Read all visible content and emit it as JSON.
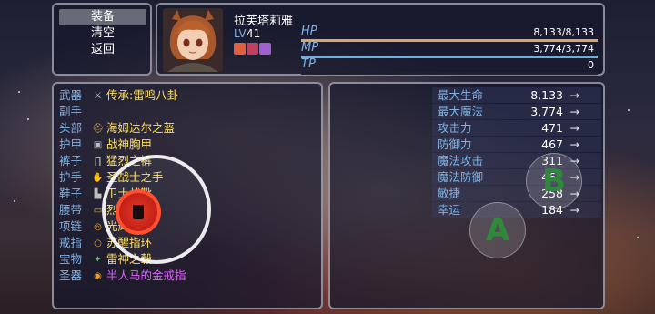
{
  "command_window": {
    "items": [
      {
        "label": "装备",
        "selected": true
      },
      {
        "label": "清空",
        "selected": false
      },
      {
        "label": "返回",
        "selected": false
      }
    ]
  },
  "actor": {
    "name": "拉芙塔莉雅",
    "level_label": "LV",
    "level": "41",
    "state_icons": [
      "attack-up-icon",
      "defense-up-icon",
      "magic-up-icon"
    ],
    "hp": {
      "label": "HP",
      "text": "8,133/8,133",
      "ratio": 1.0,
      "color": "#d8a868"
    },
    "mp": {
      "label": "MP",
      "text": "3,774/3,774",
      "ratio": 1.0,
      "color": "#6ab0e0"
    },
    "tp": {
      "label": "TP",
      "text": "0",
      "ratio": 0.0,
      "color": "#6ad080"
    }
  },
  "equipment": [
    {
      "slot": "武器",
      "icon": "sword-icon",
      "item": "传承:雷鸣八卦"
    },
    {
      "slot": "副手",
      "icon": "",
      "item": ""
    },
    {
      "slot": "头部",
      "icon": "helmet-icon",
      "item": "海姆达尔之盔"
    },
    {
      "slot": "护甲",
      "icon": "armor-icon",
      "item": "战神胸甲"
    },
    {
      "slot": "裤子",
      "icon": "pants-icon",
      "item": "猛烈之裤"
    },
    {
      "slot": "护手",
      "icon": "gauntlet-icon",
      "item": "圣战士之手"
    },
    {
      "slot": "鞋子",
      "icon": "boots-icon",
      "item": "卫士战靴"
    },
    {
      "slot": "腰带",
      "icon": "belt-icon",
      "item": "烈焰腰带"
    },
    {
      "slot": "项链",
      "icon": "necklace-icon",
      "item": "光辉项链"
    },
    {
      "slot": "戒指",
      "icon": "ring-icon",
      "item": "苏醒指环"
    },
    {
      "slot": "宝物",
      "icon": "treasure-icon",
      "item": "雷神之毂"
    },
    {
      "slot": "圣器",
      "icon": "relic-ring-icon",
      "item": "半人马的金戒指"
    }
  ],
  "parameters": [
    {
      "name": "最大生命",
      "value": "8,133",
      "arrow": "→"
    },
    {
      "name": "最大魔法",
      "value": "3,774",
      "arrow": "→"
    },
    {
      "name": "攻击力",
      "value": "471",
      "arrow": "→"
    },
    {
      "name": "防御力",
      "value": "467",
      "arrow": "→"
    },
    {
      "name": "魔法攻击",
      "value": "311",
      "arrow": "→"
    },
    {
      "name": "魔法防御",
      "value": "462",
      "arrow": "→"
    },
    {
      "name": "敏捷",
      "value": "258",
      "arrow": "→"
    },
    {
      "name": "幸运",
      "value": "184",
      "arrow": "→"
    }
  ],
  "controls": {
    "a_label": "A",
    "b_label": "B"
  },
  "colors": {
    "system_label": "#7fb2e6",
    "item_text": "#ffe060",
    "relic_text": "#e060ff"
  }
}
